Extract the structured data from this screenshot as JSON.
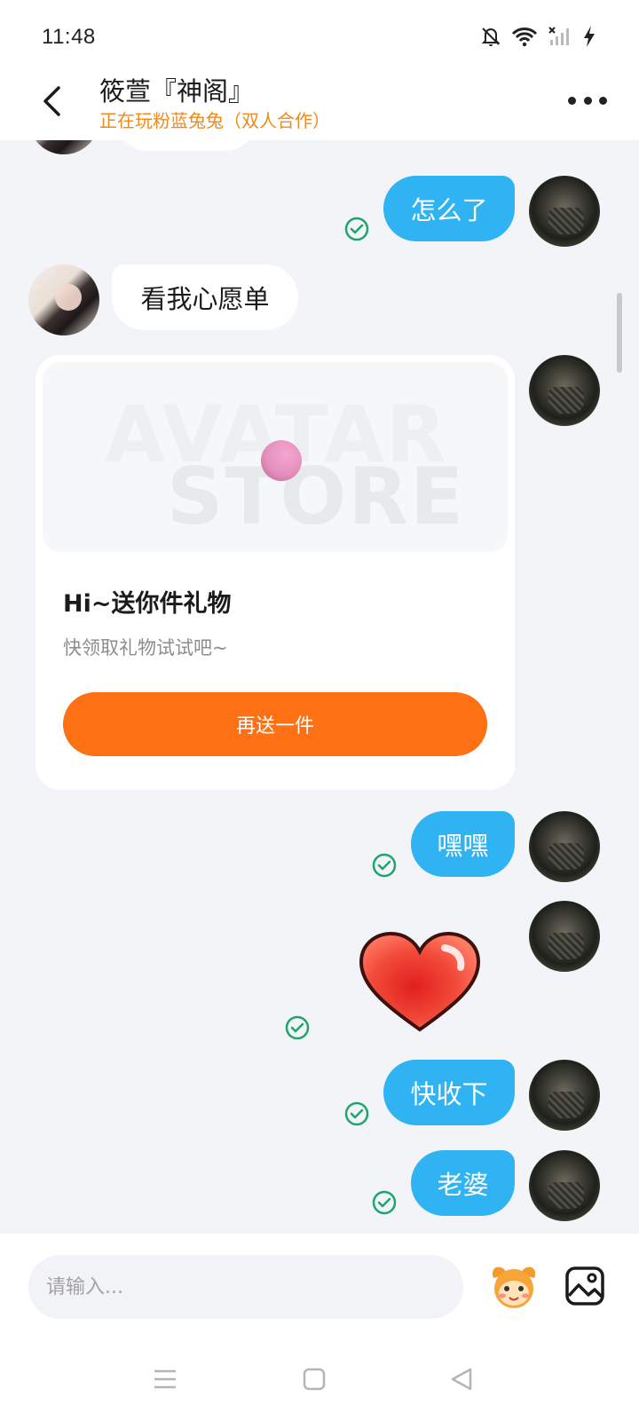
{
  "status_bar": {
    "time": "11:48",
    "icons": [
      "mute-bell-icon",
      "wifi-icon",
      "signal-icon",
      "charging-icon"
    ]
  },
  "header": {
    "title": "筱萱『神阁』",
    "subtitle": "正在玩粉蓝兔兔（双人合作）",
    "icons": [
      "back-arrow-icon",
      "more-dots-icon"
    ]
  },
  "colors": {
    "my_bubble": "#2fb3f3",
    "subtitle": "#f08a1c",
    "gift_button": "#fd7013",
    "read_check": "#1fa46c"
  },
  "messages": [
    {
      "from": "me",
      "text": "怎么了",
      "read": true
    },
    {
      "from": "other",
      "text": "看我心愿单"
    },
    {
      "from": "other",
      "type": "gift_card"
    },
    {
      "from": "me",
      "text": "嘿嘿",
      "read": true
    },
    {
      "from": "me",
      "type": "sticker",
      "sticker": "heart-sticker-icon",
      "read": true
    },
    {
      "from": "me",
      "text": "快收下",
      "read": true
    },
    {
      "from": "me",
      "text": "老婆",
      "read": true
    }
  ],
  "gift_card": {
    "banner_watermark_line1": "AVATAR",
    "banner_watermark_line2": "STORE",
    "title": "Hi~送你件礼物",
    "description": "快领取礼物试试吧~",
    "button_label": "再送一件"
  },
  "input_bar": {
    "placeholder": "请输入...",
    "icons": [
      "emoji-mascot-icon",
      "image-icon"
    ]
  },
  "nav_bar": {
    "icons": [
      "menu-icon",
      "home-square-icon",
      "back-triangle-icon"
    ]
  }
}
